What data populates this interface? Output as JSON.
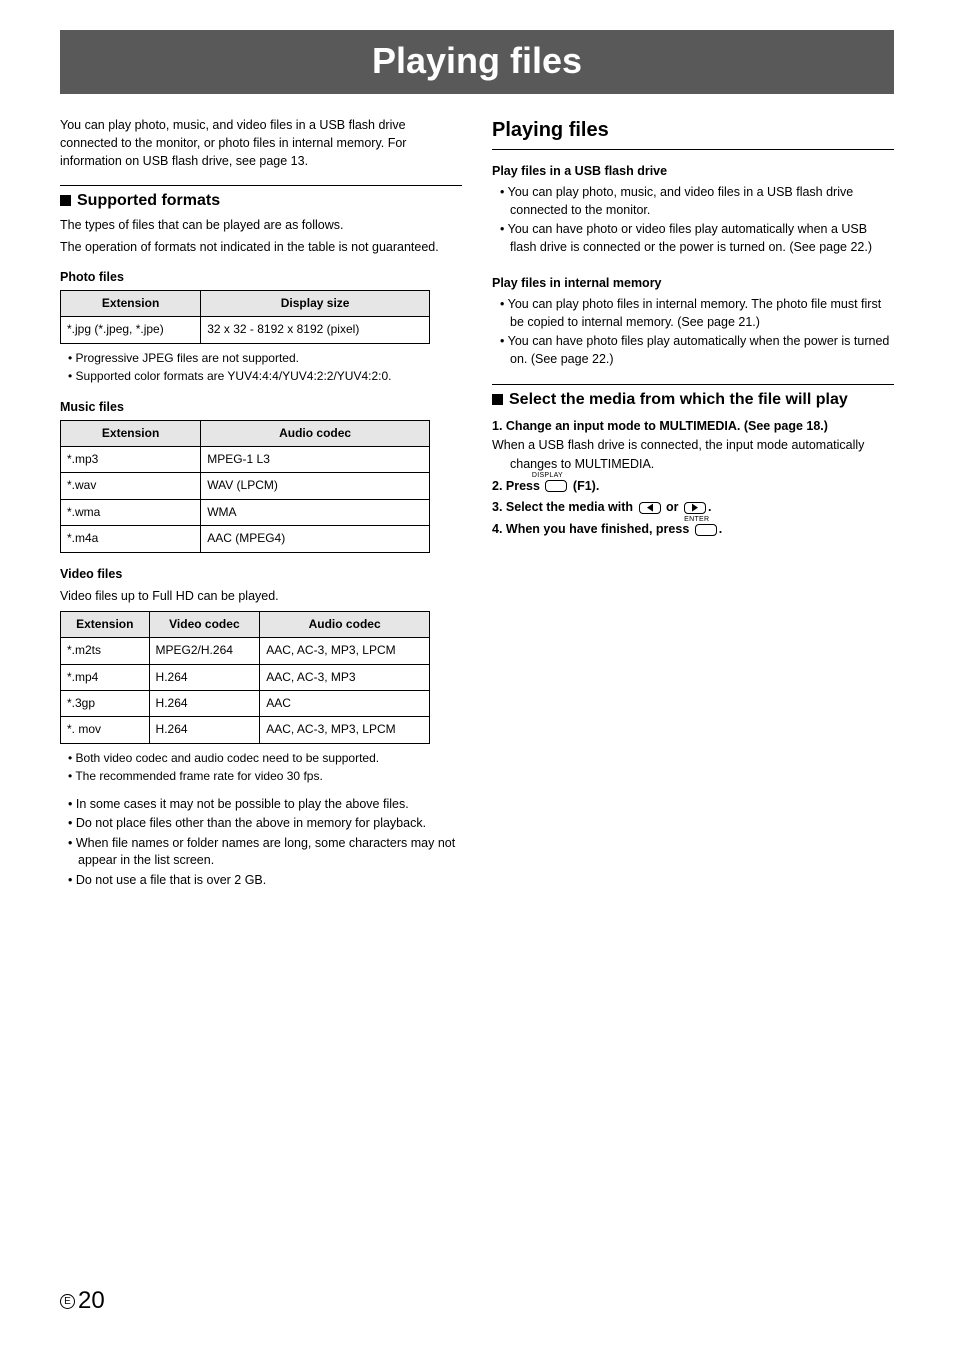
{
  "pageTitle": "Playing files",
  "pageNumber": "20",
  "circleLetter": "E",
  "left": {
    "intro": "You can play photo, music, and video files in a USB flash drive connected to the monitor, or photo files in internal memory. For information on USB flash drive, see page 13.",
    "supportedHeading": "Supported formats",
    "supportedDesc1": "The types of files that can be played are as follows.",
    "supportedDesc2": "The operation of formats not indicated in the table is not guaranteed.",
    "photoHeading": "Photo files",
    "photoTable": {
      "headers": [
        "Extension",
        "Display size"
      ],
      "rows": [
        [
          "*.jpg (*.jpeg, *.jpe)",
          "32 x 32 - 8192 x 8192 (pixel)"
        ]
      ]
    },
    "photoNotes": [
      "Progressive JPEG files are not supported.",
      "Supported color formats are YUV4:4:4/YUV4:2:2/YUV4:2:0."
    ],
    "musicHeading": "Music files",
    "musicTable": {
      "headers": [
        "Extension",
        "Audio codec"
      ],
      "rows": [
        [
          "*.mp3",
          "MPEG-1 L3"
        ],
        [
          "*.wav",
          "WAV (LPCM)"
        ],
        [
          "*.wma",
          "WMA"
        ],
        [
          "*.m4a",
          "AAC (MPEG4)"
        ]
      ]
    },
    "videoHeading": "Video files",
    "videoDesc": "Video files up to Full HD can be played.",
    "videoTable": {
      "headers": [
        "Extension",
        "Video codec",
        "Audio codec"
      ],
      "rows": [
        [
          "*.m2ts",
          "MPEG2/H.264",
          "AAC, AC-3, MP3, LPCM"
        ],
        [
          "*.mp4",
          "H.264",
          "AAC, AC-3, MP3"
        ],
        [
          "*.3gp",
          "H.264",
          "AAC"
        ],
        [
          "*. mov",
          "H.264",
          "AAC, AC-3, MP3, LPCM"
        ]
      ]
    },
    "videoNotes": [
      "Both video codec and audio codec need to be supported.",
      "The recommended frame rate for video 30 fps."
    ],
    "generalNotes": [
      "In some cases it may not be possible to play the above files.",
      "Do not place files other than the above in memory for playback.",
      "When file names or folder names are long, some characters may not appear in the list screen.",
      "Do not use a file that is over 2 GB."
    ]
  },
  "right": {
    "heading": "Playing files",
    "usbHeading": "Play files in a USB flash drive",
    "usbBullets": [
      "You can play photo, music, and video files in a USB flash drive connected to the monitor.",
      "You can have photo or video files play automatically when a USB flash drive is connected or the power is turned on. (See page 22.)"
    ],
    "internalHeading": "Play files in internal memory",
    "internalBullets": [
      "You can play photo files in internal memory. The photo file must first be copied to internal memory. (See page 21.)",
      "You can have photo files play automatically when the power is turned on. (See page 22.)"
    ],
    "selectHeading": "Select the media from which the file will play",
    "step1Bold": "Change an input mode to MULTIMEDIA. (See page 18.)",
    "step1Normal": "When a USB flash drive is connected, the input mode automatically changes to MULTIMEDIA.",
    "step2a": "Press ",
    "step2b": " (F1).",
    "step3a": "Select the media with ",
    "step3b": " or ",
    "step3c": ".",
    "step4a": "When you have finished, press ",
    "step4b": ".",
    "keyDisplay": "DISPLAY",
    "keyEnter": "ENTER"
  }
}
